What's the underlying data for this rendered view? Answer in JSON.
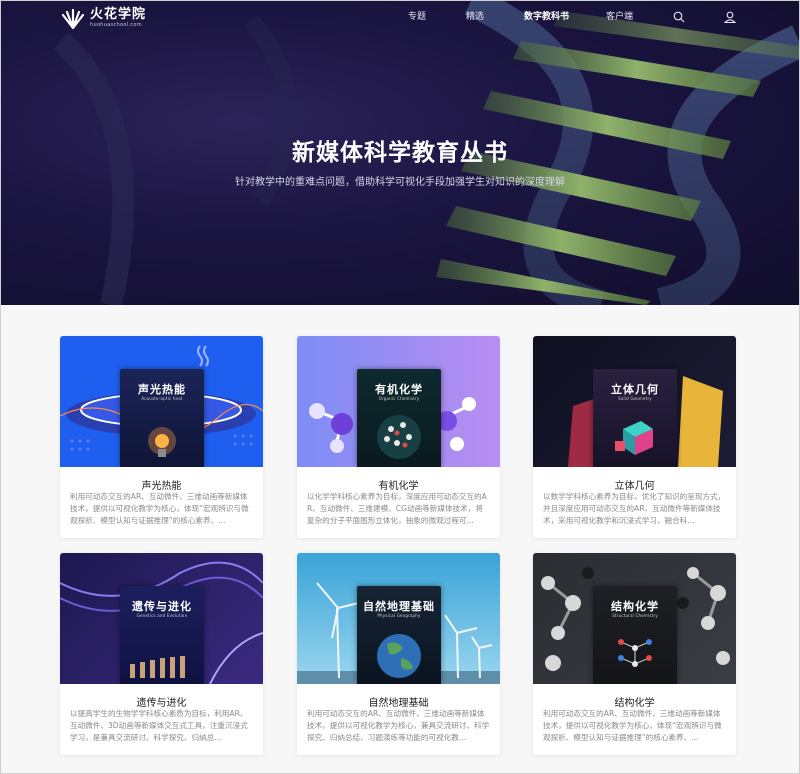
{
  "site": {
    "logo_name": "火花学院",
    "logo_sub": "huohuaschool.com"
  },
  "nav": {
    "items": [
      {
        "label": "专题",
        "active": false
      },
      {
        "label": "精选",
        "active": false
      },
      {
        "label": "数字教科书",
        "active": true
      },
      {
        "label": "客户端",
        "active": false
      }
    ],
    "search_icon": "search-icon",
    "user_icon": "user-icon"
  },
  "hero": {
    "title": "新媒体科学教育丛书",
    "subtitle": "针对教学中的重难点问题，借助科学可视化手段加强学生对知识的深度理解"
  },
  "cards": [
    {
      "title": "声光热能",
      "book_title": "声光热能",
      "book_en": "Acousto-optic heat",
      "desc": "利用可动态交互的AR、互动微件、三维动画等新媒体技术，提供以可视化教学为核心，体现“宏观辨识与微观探析、模型认知与证据推理”的核心素养、...",
      "accent": "#1f5ff0"
    },
    {
      "title": "有机化学",
      "book_title": "有机化学",
      "book_en": "Organic Chemistry",
      "desc": "以化学学科核心素养为目标，深度应用可动态交互的AR、互动微件、三维建模、CG动画等新媒体技术，将复杂的分子平面图形立体化，抽象的微观过程可...",
      "accent": "#a58cf6"
    },
    {
      "title": "立体几何",
      "book_title": "立体几何",
      "book_en": "Solid Geometry",
      "desc": "以数学学科核心素养为目标，优化了知识的呈现方式，并且深度应用可动态交互的AR、互动微件等新媒体技术，采用可视化教学和沉浸式学习，融合科...",
      "accent": "#141428"
    },
    {
      "title": "遗传与进化",
      "book_title": "遗传与进化",
      "book_en": "Genetics and Evolution",
      "desc": "以提高学生的生物学学科核心素质为目标，利用AR、互动微件、3D动画等新媒体交互式工具，注重沉浸式学习，是兼具交流研讨、科学探究、归纳总...",
      "accent": "#2a1c5e"
    },
    {
      "title": "自然地理基础",
      "book_title": "自然地理基础",
      "book_en": "Physical Geography",
      "desc": "利用可动态交互的AR、互动微件、三维动画等新媒体技术，提供以可视化教学为核心，兼具交流研讨、科学探究、归纳总结、习题演练等功能的可视化教...",
      "accent": "#3fa6d8"
    },
    {
      "title": "结构化学",
      "book_title": "结构化学",
      "book_en": "Structural Chemistry",
      "desc": "利用可动态交互的AR、互动微件、三维动画等新媒体技术，提供以可视化教学为核心，体现“宏观辨识与微观探析、模型认知与证据推理”的核心素养、...",
      "accent": "#2b2d33"
    }
  ]
}
